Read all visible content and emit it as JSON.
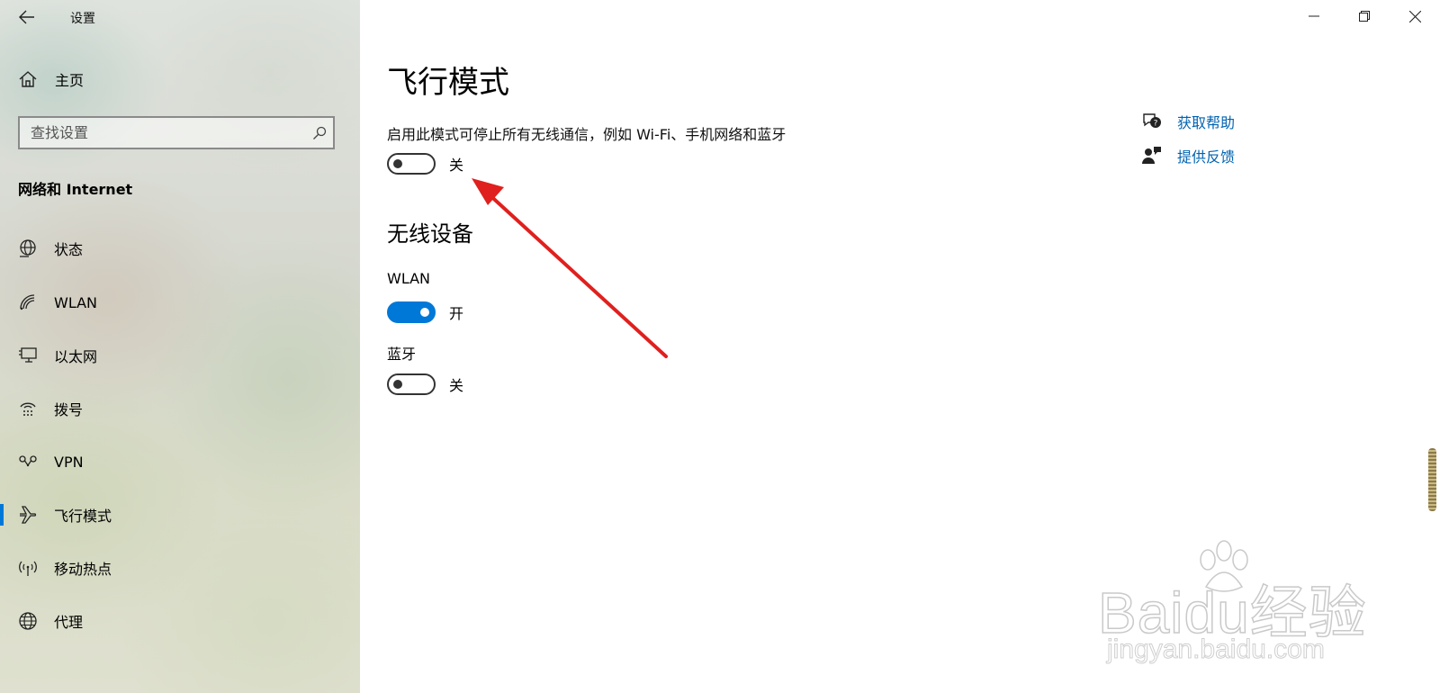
{
  "window": {
    "app_title": "设置"
  },
  "sidebar": {
    "home_label": "主页",
    "search_placeholder": "查找设置",
    "section_title": "网络和 Internet",
    "items": [
      {
        "label": "状态",
        "icon": "globe-status-icon"
      },
      {
        "label": "WLAN",
        "icon": "wifi-icon"
      },
      {
        "label": "以太网",
        "icon": "ethernet-icon"
      },
      {
        "label": "拨号",
        "icon": "dialup-icon"
      },
      {
        "label": "VPN",
        "icon": "vpn-icon"
      },
      {
        "label": "飞行模式",
        "icon": "airplane-icon",
        "selected": true
      },
      {
        "label": "移动热点",
        "icon": "hotspot-icon"
      },
      {
        "label": "代理",
        "icon": "globe-icon"
      }
    ]
  },
  "main": {
    "title": "飞行模式",
    "description": "启用此模式可停止所有无线通信，例如 Wi-Fi、手机网络和蓝牙",
    "airplane_toggle": {
      "state": "关",
      "on": false
    },
    "wireless_section_title": "无线设备",
    "wlan": {
      "label": "WLAN",
      "state": "开",
      "on": true
    },
    "bluetooth": {
      "label": "蓝牙",
      "state": "关",
      "on": false
    }
  },
  "help": {
    "get_help": "获取帮助",
    "give_feedback": "提供反馈"
  },
  "watermark": {
    "main": "Baidu经验",
    "sub": "jingyan.baidu.com"
  },
  "colors": {
    "accent": "#0078d7",
    "link": "#0063b1",
    "annotation_arrow": "#e0201e"
  }
}
